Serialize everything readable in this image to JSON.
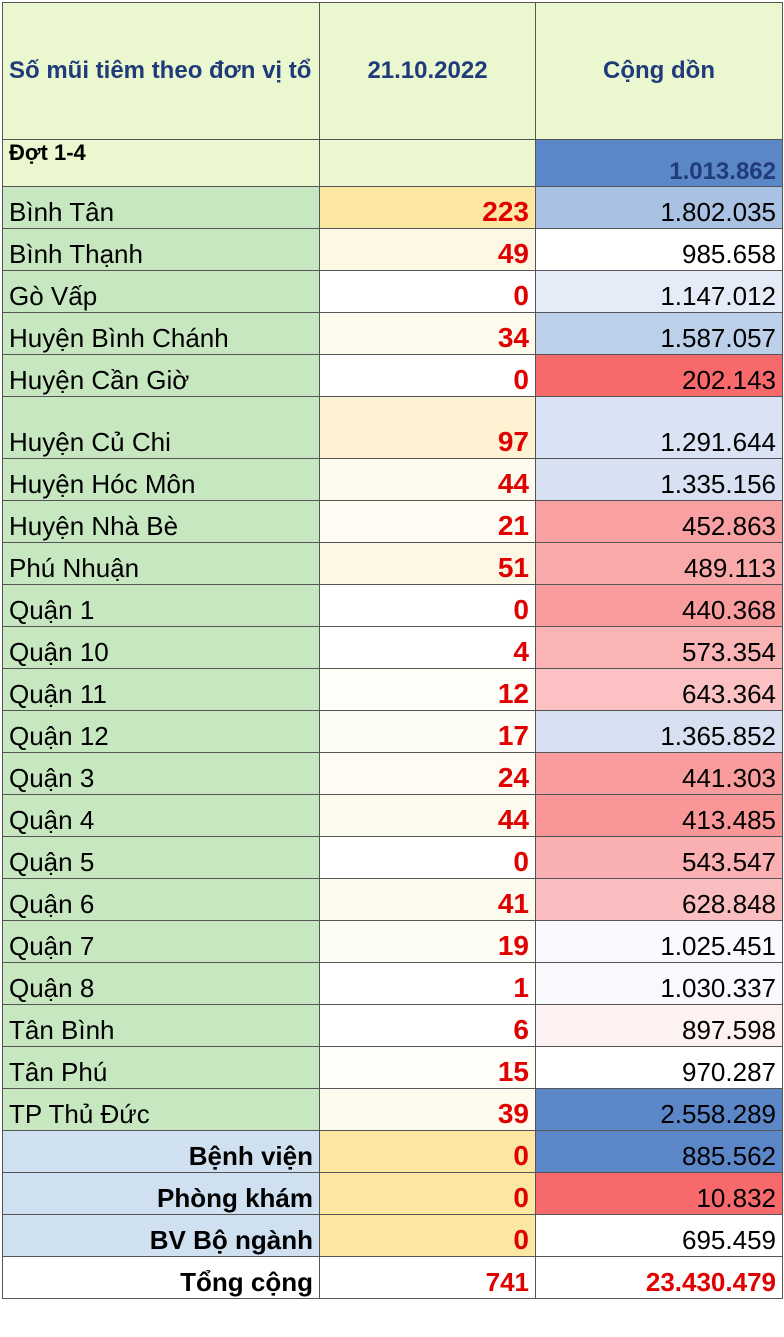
{
  "header": {
    "col1": "Số mũi tiêm theo đơn vị tổ chức tiêm",
    "col2": "21.10.2022",
    "col3": "Cộng dồn"
  },
  "first_row": {
    "name": "Đợt 1-4",
    "daily": "",
    "cumulative": "1.013.862",
    "cum_color": "#5b87c8"
  },
  "rows": [
    {
      "name": "Bình Tân",
      "daily": "223",
      "cumulative": "1.802.035",
      "daily_bg": "#fbe6a2",
      "cum_bg": "#a9c2e3"
    },
    {
      "name": "Bình Thạnh",
      "daily": "49",
      "cumulative": "985.658",
      "daily_bg": "#fdf8e4",
      "cum_bg": "#ffffff"
    },
    {
      "name": "Gò Vấp",
      "daily": "0",
      "cumulative": "1.147.012",
      "daily_bg": "#ffffff",
      "cum_bg": "#e5ecf7"
    },
    {
      "name": "Huyện Bình Chánh",
      "daily": "34",
      "cumulative": "1.587.057",
      "daily_bg": "#fdfbee",
      "cum_bg": "#bcd0ea"
    },
    {
      "name": "Huyện Cần Giờ",
      "daily": "0",
      "cumulative": "202.143",
      "daily_bg": "#ffffff",
      "cum_bg": "#f7696b"
    },
    {
      "name": "Huyện Củ Chi",
      "daily": "97",
      "cumulative": "1.291.644",
      "daily_bg": "#fdf3d2",
      "cum_bg": "#d9e3f3"
    },
    {
      "name": "Huyện Hóc Môn",
      "daily": "44",
      "cumulative": "1.335.156",
      "daily_bg": "#fdfbee",
      "cum_bg": "#d7e1f2"
    },
    {
      "name": "Huyện Nhà Bè",
      "daily": "21",
      "cumulative": "452.863",
      "daily_bg": "#fefcf3",
      "cum_bg": "#f9a0a2"
    },
    {
      "name": "Phú Nhuận",
      "daily": "51",
      "cumulative": "489.113",
      "daily_bg": "#fdf8e4",
      "cum_bg": "#faa9ab"
    },
    {
      "name": "Quận 1",
      "daily": "0",
      "cumulative": "440.368",
      "daily_bg": "#ffffff",
      "cum_bg": "#f99c9e"
    },
    {
      "name": "Quận 10",
      "daily": "4",
      "cumulative": "573.354",
      "daily_bg": "#ffffff",
      "cum_bg": "#fab4b6"
    },
    {
      "name": "Quận 11",
      "daily": "12",
      "cumulative": "643.364",
      "daily_bg": "#fefdf8",
      "cum_bg": "#fbc1c3"
    },
    {
      "name": "Quận 12",
      "daily": "17",
      "cumulative": "1.365.852",
      "daily_bg": "#fefdf5",
      "cum_bg": "#d6e0f1"
    },
    {
      "name": "Quận 3",
      "daily": "24",
      "cumulative": "441.303",
      "daily_bg": "#fefcf2",
      "cum_bg": "#f99c9e"
    },
    {
      "name": "Quận 4",
      "daily": "44",
      "cumulative": "413.485",
      "daily_bg": "#fdfbee",
      "cum_bg": "#f99698"
    },
    {
      "name": "Quận 5",
      "daily": "0",
      "cumulative": "543.547",
      "daily_bg": "#ffffff",
      "cum_bg": "#fab0b2"
    },
    {
      "name": "Quận 6",
      "daily": "41",
      "cumulative": "628.848",
      "daily_bg": "#fdfbee",
      "cum_bg": "#fbbec0"
    },
    {
      "name": "Quận 7",
      "daily": "19",
      "cumulative": "1.025.451",
      "daily_bg": "#fefdf5",
      "cum_bg": "#f8fafd"
    },
    {
      "name": "Quận 8",
      "daily": "1",
      "cumulative": "1.030.337",
      "daily_bg": "#ffffff",
      "cum_bg": "#f7f9fd"
    },
    {
      "name": "Tân Bình",
      "daily": "6",
      "cumulative": "897.598",
      "daily_bg": "#ffffff",
      "cum_bg": "#fdf1f2"
    },
    {
      "name": "Tân Phú",
      "daily": "15",
      "cumulative": "970.287",
      "daily_bg": "#fefdf8",
      "cum_bg": "#ffffff"
    },
    {
      "name": "TP Thủ Đức",
      "daily": "39",
      "cumulative": "2.558.289",
      "daily_bg": "#fdfbee",
      "cum_bg": "#5b87c8"
    }
  ],
  "institutions": [
    {
      "name": "Bệnh viện",
      "daily": "0",
      "cumulative": "885.562",
      "daily_bg": "#fbe6a2",
      "cum_bg": "#5b87c8"
    },
    {
      "name": "Phòng khám",
      "daily": "0",
      "cumulative": "10.832",
      "daily_bg": "#fbe6a2",
      "cum_bg": "#f7696b"
    },
    {
      "name": "BV Bộ ngành",
      "daily": "0",
      "cumulative": "695.459",
      "daily_bg": "#fbe6a2",
      "cum_bg": "#ffffff"
    }
  ],
  "total": {
    "name": "Tổng cộng",
    "daily": "741",
    "cumulative": "23.430.479"
  }
}
